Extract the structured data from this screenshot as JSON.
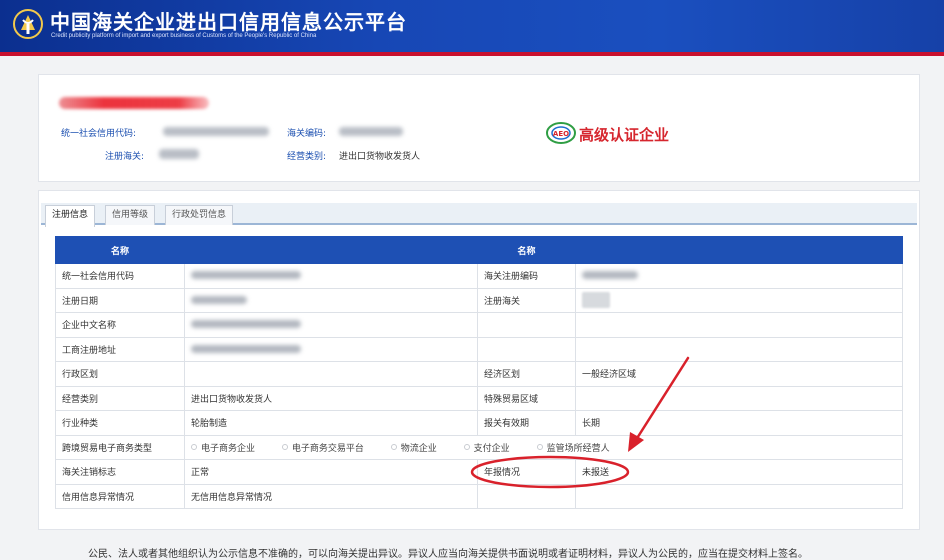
{
  "header": {
    "title": "中国海关企业进出口信用信息公示平台",
    "subtitle": "Credit publicity platform of import and export business of Customs of the People's Republic of China"
  },
  "info": {
    "credit_code_label": "统一社会信用代码:",
    "reg_customs_label": "注册海关:",
    "customs_code_label": "海关编码:",
    "business_type_label": "经营类别:",
    "business_type_value": "进出口货物收发货人",
    "badge_small": "AEO",
    "badge_text": "高级认证企业"
  },
  "tabs": [
    "注册信息",
    "信用等级",
    "行政处罚信息"
  ],
  "table": {
    "header_left": "名称",
    "header_right": "名称",
    "rows": [
      {
        "k1": "统一社会信用代码",
        "v1": "",
        "k2": "海关注册编码",
        "v2": ""
      },
      {
        "k1": "注册日期",
        "v1": "",
        "k2": "注册海关",
        "v2": ""
      },
      {
        "k1": "企业中文名称",
        "v1": "",
        "k2": "",
        "v2": ""
      },
      {
        "k1": "工商注册地址",
        "v1": "",
        "k2": "",
        "v2": ""
      },
      {
        "k1": "行政区划",
        "v1": "",
        "k2": "经济区划",
        "v2": "一般经济区域"
      },
      {
        "k1": "经营类别",
        "v1": "进出口货物收发货人",
        "k2": "特殊贸易区域",
        "v2": ""
      },
      {
        "k1": "行业种类",
        "v1": "轮胎制造",
        "k2": "报关有效期",
        "v2": "长期"
      },
      {
        "k1": "海关注销标志",
        "v1": "正常",
        "k2": "年报情况",
        "v2": "未报送"
      },
      {
        "k1": "信用信息异常情况",
        "v1": "无信用信息异常情况",
        "k2": "",
        "v2": ""
      }
    ],
    "ecommerce_label": "跨境贸易电子商务类型",
    "ecommerce_options": [
      "电子商务企业",
      "电子商务交易平台",
      "物流企业",
      "支付企业",
      "监管场所经营人"
    ]
  },
  "footer_text": "公民、法人或者其他组织认为公示信息不准确的，可以向海关提出异议。异议人应当向海关提供书面说明或者证明材料，异议人为公民的，应当在提交材料上签名。",
  "colors": {
    "banner": "#1747b5",
    "header_row": "#1e50b4",
    "annotation": "#d9212b",
    "badge": "#d6262e"
  }
}
